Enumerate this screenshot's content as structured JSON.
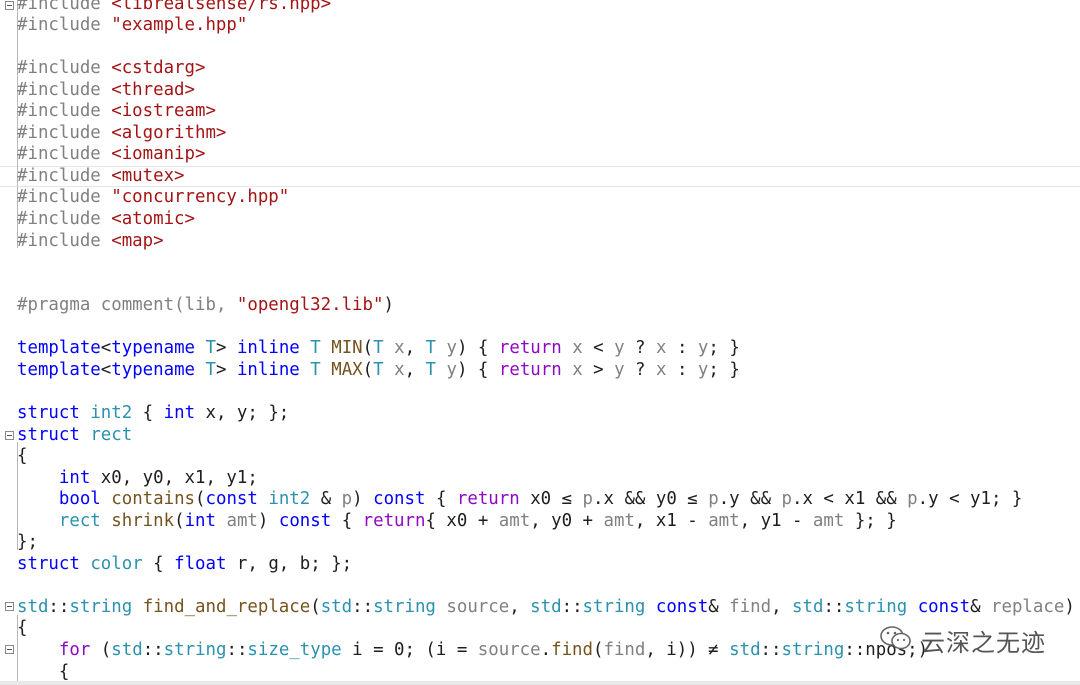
{
  "editor": {
    "lines": [
      [
        {
          "t": "#include ",
          "c": "pp"
        },
        {
          "t": "<librealsense/rs.hpp>",
          "c": "str"
        }
      ],
      [
        {
          "t": "#include ",
          "c": "pp"
        },
        {
          "t": "\"example.hpp\"",
          "c": "str"
        }
      ],
      [],
      [
        {
          "t": "#include ",
          "c": "pp"
        },
        {
          "t": "<cstdarg>",
          "c": "str"
        }
      ],
      [
        {
          "t": "#include ",
          "c": "pp"
        },
        {
          "t": "<thread>",
          "c": "str"
        }
      ],
      [
        {
          "t": "#include ",
          "c": "pp"
        },
        {
          "t": "<iostream>",
          "c": "str"
        }
      ],
      [
        {
          "t": "#include ",
          "c": "pp"
        },
        {
          "t": "<algorithm>",
          "c": "str"
        }
      ],
      [
        {
          "t": "#include ",
          "c": "pp"
        },
        {
          "t": "<iomanip>",
          "c": "str"
        }
      ],
      [
        {
          "t": "#include ",
          "c": "pp"
        },
        {
          "t": "<mutex>",
          "c": "str"
        }
      ],
      [
        {
          "t": "#include ",
          "c": "pp"
        },
        {
          "t": "\"concurrency.hpp\"",
          "c": "str"
        }
      ],
      [
        {
          "t": "#include ",
          "c": "pp"
        },
        {
          "t": "<atomic>",
          "c": "str"
        }
      ],
      [
        {
          "t": "#include ",
          "c": "pp"
        },
        {
          "t": "<map>",
          "c": "str"
        }
      ],
      [],
      [],
      [
        {
          "t": "#pragma comment",
          "c": "pp"
        },
        {
          "t": "(lib, ",
          "c": "pp"
        },
        {
          "t": "\"opengl32.lib\"",
          "c": "str"
        },
        {
          "t": ")",
          "c": "op"
        }
      ],
      [],
      [
        {
          "t": "template",
          "c": "kw"
        },
        {
          "t": "<",
          "c": "op"
        },
        {
          "t": "typename",
          "c": "kw"
        },
        {
          "t": " ",
          "c": "op"
        },
        {
          "t": "T",
          "c": "ty"
        },
        {
          "t": "> ",
          "c": "op"
        },
        {
          "t": "inline",
          "c": "kw"
        },
        {
          "t": " ",
          "c": "op"
        },
        {
          "t": "T",
          "c": "ty"
        },
        {
          "t": " ",
          "c": "op"
        },
        {
          "t": "MIN",
          "c": "fn"
        },
        {
          "t": "(",
          "c": "op"
        },
        {
          "t": "T",
          "c": "ty"
        },
        {
          "t": " ",
          "c": "op"
        },
        {
          "t": "x",
          "c": "pr"
        },
        {
          "t": ", ",
          "c": "op"
        },
        {
          "t": "T",
          "c": "ty"
        },
        {
          "t": " ",
          "c": "op"
        },
        {
          "t": "y",
          "c": "pr"
        },
        {
          "t": ") { ",
          "c": "op"
        },
        {
          "t": "return",
          "c": "ctl"
        },
        {
          "t": " ",
          "c": "op"
        },
        {
          "t": "x",
          "c": "pr"
        },
        {
          "t": " < ",
          "c": "op"
        },
        {
          "t": "y",
          "c": "pr"
        },
        {
          "t": " ? ",
          "c": "op"
        },
        {
          "t": "x",
          "c": "pr"
        },
        {
          "t": " : ",
          "c": "op"
        },
        {
          "t": "y",
          "c": "pr"
        },
        {
          "t": "; }",
          "c": "op"
        }
      ],
      [
        {
          "t": "template",
          "c": "kw"
        },
        {
          "t": "<",
          "c": "op"
        },
        {
          "t": "typename",
          "c": "kw"
        },
        {
          "t": " ",
          "c": "op"
        },
        {
          "t": "T",
          "c": "ty"
        },
        {
          "t": "> ",
          "c": "op"
        },
        {
          "t": "inline",
          "c": "kw"
        },
        {
          "t": " ",
          "c": "op"
        },
        {
          "t": "T",
          "c": "ty"
        },
        {
          "t": " ",
          "c": "op"
        },
        {
          "t": "MAX",
          "c": "fn"
        },
        {
          "t": "(",
          "c": "op"
        },
        {
          "t": "T",
          "c": "ty"
        },
        {
          "t": " ",
          "c": "op"
        },
        {
          "t": "x",
          "c": "pr"
        },
        {
          "t": ", ",
          "c": "op"
        },
        {
          "t": "T",
          "c": "ty"
        },
        {
          "t": " ",
          "c": "op"
        },
        {
          "t": "y",
          "c": "pr"
        },
        {
          "t": ") { ",
          "c": "op"
        },
        {
          "t": "return",
          "c": "ctl"
        },
        {
          "t": " ",
          "c": "op"
        },
        {
          "t": "x",
          "c": "pr"
        },
        {
          "t": " > ",
          "c": "op"
        },
        {
          "t": "y",
          "c": "pr"
        },
        {
          "t": " ? ",
          "c": "op"
        },
        {
          "t": "x",
          "c": "pr"
        },
        {
          "t": " : ",
          "c": "op"
        },
        {
          "t": "y",
          "c": "pr"
        },
        {
          "t": "; }",
          "c": "op"
        }
      ],
      [],
      [
        {
          "t": "struct",
          "c": "kw"
        },
        {
          "t": " ",
          "c": "op"
        },
        {
          "t": "int2",
          "c": "ty"
        },
        {
          "t": " { ",
          "c": "op"
        },
        {
          "t": "int",
          "c": "kw"
        },
        {
          "t": " x, y; };",
          "c": "op"
        }
      ],
      [
        {
          "t": "struct",
          "c": "kw"
        },
        {
          "t": " ",
          "c": "op"
        },
        {
          "t": "rect",
          "c": "ty"
        }
      ],
      [
        {
          "t": "{",
          "c": "op"
        }
      ],
      [
        {
          "t": "    ",
          "c": "op"
        },
        {
          "t": "int",
          "c": "kw"
        },
        {
          "t": " x0, y0, x1, y1;",
          "c": "op"
        }
      ],
      [
        {
          "t": "    ",
          "c": "op"
        },
        {
          "t": "bool",
          "c": "kw"
        },
        {
          "t": " ",
          "c": "op"
        },
        {
          "t": "contains",
          "c": "fn"
        },
        {
          "t": "(",
          "c": "op"
        },
        {
          "t": "const",
          "c": "kw"
        },
        {
          "t": " ",
          "c": "op"
        },
        {
          "t": "int2",
          "c": "ty"
        },
        {
          "t": " & ",
          "c": "op"
        },
        {
          "t": "p",
          "c": "pr"
        },
        {
          "t": ") ",
          "c": "op"
        },
        {
          "t": "const",
          "c": "kw"
        },
        {
          "t": " { ",
          "c": "op"
        },
        {
          "t": "return",
          "c": "ctl"
        },
        {
          "t": " x0 ≤ ",
          "c": "op"
        },
        {
          "t": "p",
          "c": "pr"
        },
        {
          "t": ".x && y0 ≤ ",
          "c": "op"
        },
        {
          "t": "p",
          "c": "pr"
        },
        {
          "t": ".y && ",
          "c": "op"
        },
        {
          "t": "p",
          "c": "pr"
        },
        {
          "t": ".x < x1 && ",
          "c": "op"
        },
        {
          "t": "p",
          "c": "pr"
        },
        {
          "t": ".y < y1; }",
          "c": "op"
        }
      ],
      [
        {
          "t": "    ",
          "c": "op"
        },
        {
          "t": "rect",
          "c": "ty"
        },
        {
          "t": " ",
          "c": "op"
        },
        {
          "t": "shrink",
          "c": "fn"
        },
        {
          "t": "(",
          "c": "op"
        },
        {
          "t": "int",
          "c": "kw"
        },
        {
          "t": " ",
          "c": "op"
        },
        {
          "t": "amt",
          "c": "pr"
        },
        {
          "t": ") ",
          "c": "op"
        },
        {
          "t": "const",
          "c": "kw"
        },
        {
          "t": " { ",
          "c": "op"
        },
        {
          "t": "return",
          "c": "ctl"
        },
        {
          "t": "{ x0 + ",
          "c": "op"
        },
        {
          "t": "amt",
          "c": "pr"
        },
        {
          "t": ", y0 + ",
          "c": "op"
        },
        {
          "t": "amt",
          "c": "pr"
        },
        {
          "t": ", x1 - ",
          "c": "op"
        },
        {
          "t": "amt",
          "c": "pr"
        },
        {
          "t": ", y1 - ",
          "c": "op"
        },
        {
          "t": "amt",
          "c": "pr"
        },
        {
          "t": " }; }",
          "c": "op"
        }
      ],
      [
        {
          "t": "};",
          "c": "op"
        }
      ],
      [
        {
          "t": "struct",
          "c": "kw"
        },
        {
          "t": " ",
          "c": "op"
        },
        {
          "t": "color",
          "c": "ty"
        },
        {
          "t": " { ",
          "c": "op"
        },
        {
          "t": "float",
          "c": "kw"
        },
        {
          "t": " r, g, b; };",
          "c": "op"
        }
      ],
      [],
      [
        {
          "t": "std",
          "c": "ty"
        },
        {
          "t": "::",
          "c": "op"
        },
        {
          "t": "string",
          "c": "ty"
        },
        {
          "t": " ",
          "c": "op"
        },
        {
          "t": "find_and_replace",
          "c": "fn"
        },
        {
          "t": "(",
          "c": "op"
        },
        {
          "t": "std",
          "c": "ty"
        },
        {
          "t": "::",
          "c": "op"
        },
        {
          "t": "string",
          "c": "ty"
        },
        {
          "t": " ",
          "c": "op"
        },
        {
          "t": "source",
          "c": "pr"
        },
        {
          "t": ", ",
          "c": "op"
        },
        {
          "t": "std",
          "c": "ty"
        },
        {
          "t": "::",
          "c": "op"
        },
        {
          "t": "string",
          "c": "ty"
        },
        {
          "t": " ",
          "c": "op"
        },
        {
          "t": "const",
          "c": "kw"
        },
        {
          "t": "& ",
          "c": "op"
        },
        {
          "t": "find",
          "c": "pr"
        },
        {
          "t": ", ",
          "c": "op"
        },
        {
          "t": "std",
          "c": "ty"
        },
        {
          "t": "::",
          "c": "op"
        },
        {
          "t": "string",
          "c": "ty"
        },
        {
          "t": " ",
          "c": "op"
        },
        {
          "t": "const",
          "c": "kw"
        },
        {
          "t": "& ",
          "c": "op"
        },
        {
          "t": "replace",
          "c": "pr"
        },
        {
          "t": ")",
          "c": "op"
        }
      ],
      [
        {
          "t": "{",
          "c": "op"
        }
      ],
      [
        {
          "t": "    ",
          "c": "op"
        },
        {
          "t": "for",
          "c": "ctl"
        },
        {
          "t": " (",
          "c": "op"
        },
        {
          "t": "std",
          "c": "ty"
        },
        {
          "t": "::",
          "c": "op"
        },
        {
          "t": "string",
          "c": "ty"
        },
        {
          "t": "::",
          "c": "op"
        },
        {
          "t": "size_type",
          "c": "ty"
        },
        {
          "t": " i = 0; (i = ",
          "c": "op"
        },
        {
          "t": "source",
          "c": "pr"
        },
        {
          "t": ".",
          "c": "op"
        },
        {
          "t": "find",
          "c": "fn"
        },
        {
          "t": "(",
          "c": "op"
        },
        {
          "t": "find",
          "c": "pr"
        },
        {
          "t": ", i)) ≠ ",
          "c": "op"
        },
        {
          "t": "std",
          "c": "ty"
        },
        {
          "t": "::",
          "c": "op"
        },
        {
          "t": "string",
          "c": "ty"
        },
        {
          "t": "::npos;)",
          "c": "op"
        }
      ],
      [
        {
          "t": "    {",
          "c": "op"
        }
      ]
    ]
  },
  "watermark": {
    "text": "云深之无迹",
    "icon": "wechat-icon"
  }
}
